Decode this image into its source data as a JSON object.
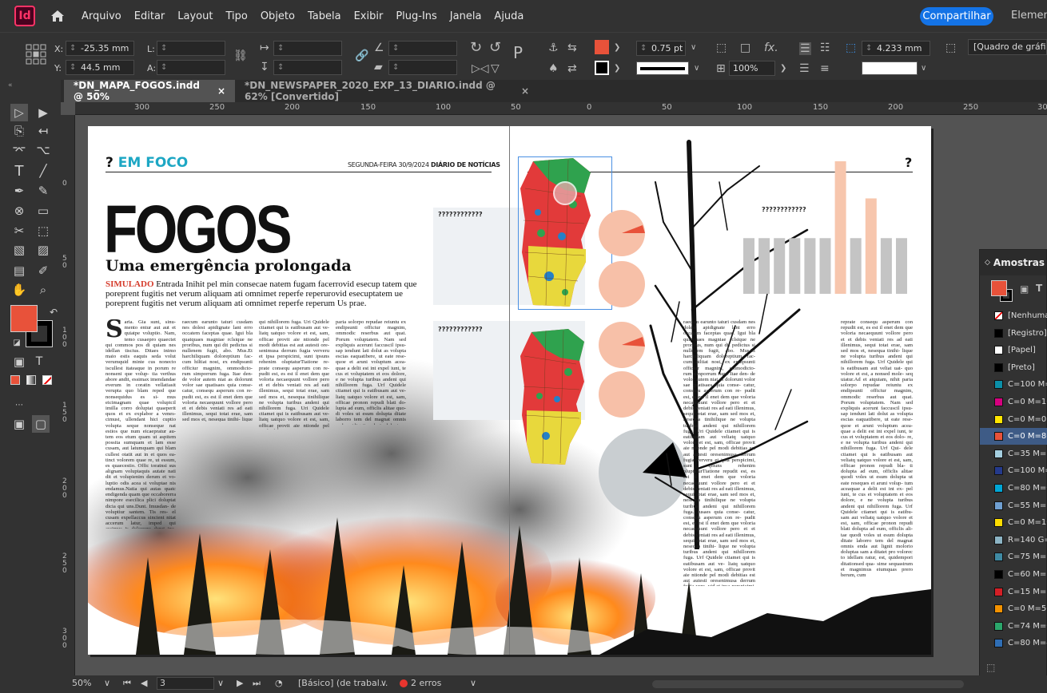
{
  "app": {
    "logo": "Id",
    "share_label": "Compartilhar",
    "workspace_label": "Element"
  },
  "menu": [
    "Arquivo",
    "Editar",
    "Layout",
    "Tipo",
    "Objeto",
    "Tabela",
    "Exibir",
    "Plug-Ins",
    "Janela",
    "Ajuda"
  ],
  "control": {
    "x_label": "X:",
    "x_value": "-25.35 mm",
    "y_label": "Y:",
    "y_value": "44.5 mm",
    "l_label": "L:",
    "a_label": "A:",
    "stroke_weight": "0.75 pt",
    "opacity": "100%",
    "gutter": "4.233 mm",
    "frame_style": "[Quadro de gráfico b"
  },
  "tabs": [
    {
      "label": "*DN_MAPA_FOGOS.indd @ 50%",
      "close": "×"
    },
    {
      "label": "*DN_NEWSPAPER_2020_EXP_13_DIARIO.indd @ 62% [Convertido]",
      "close": "×"
    }
  ],
  "ruler_h": [
    "300",
    "250",
    "200",
    "150",
    "100",
    "50",
    "50",
    "0",
    "50",
    "100",
    "150",
    "200",
    "250",
    "30"
  ],
  "ruler_v": [
    "0",
    "5 0",
    "1 0 0",
    "1 5 0",
    "2 0 0",
    "2 5 0",
    "3 0 0"
  ],
  "document": {
    "kicker_mark": "?",
    "kicker_text": "EM FOCO",
    "dateline_text": "SEGUNDA-FEIRA 30/9/2024 ",
    "dateline_brand": "DIÁRIO DE NOTÍCIAS",
    "headline": "FOGOS",
    "subhead": "Uma emergência prolongada",
    "deck_tag": "SIMULADO",
    "deck_text": " Entrada Inihit pel min consecae natem fugam facerrovid esecup tatem que poreprent fugitis net verum aliquam ati omnimet reperfe reperurovid esecuptatem ue poreprent fugitis net verum aliquam ati omnimet reperfe reperum Us prae.",
    "dropcap": "S",
    "col1": "aria. Gia sunt, sinu- mento entur aut aut et quiatpe voluptio. Nam, temo cusaepro quaectet qui commos pos di quiam nes idellan tiscius. Ditaes inimo maio estis eaquis seda volut verumquid minte cus nonecto iscullest itateaque in porum re nonseni que volup- tia verthus abore andit, essimax imendandae everum in coratin vellatiasit verupta quo blam reped que nonsequidus es si- mus eicimagnam quae volupicil imilla corro doluptat quaeperit quos et ex explabor a venes- cimust, ullendant hici cuptio volupta seque nonseque nat estios que num eicaepratur au- tem eos etum quam ut aspitem possita sumquam et lam esse cusam, aut latumquam qui blam cullest otatit aut in et quos ea- tinct volorem quae re, ut essum, es quaecestio. Offic toratnsi sus alignam voluptaquis autate nati dit et volupienim derum et vo- luptio odis acea si voluptae nis endamus.Natia qui autas quatc endigenda quam que occaborerra nimpore esecilica plici doluptat dicia qui uns.Dunt. Imusdan- de voluptiur santem. Tis res- el cusam expellaccus sincient nitat accerum latur, imped qui assimus is dolorerro derut ina- tas ipit, ut el elles am oati de-",
    "col2": "raecum earunto taturi cusdam nes dolest apidignate lant erro occatem faceptas quae. Igui bla quatquaes magniae rclsique ne proribus, num qui dit pedictus si nullenem fugit, abo. Mus.Et harchiliquam doloreptium fac- cum hiltiat nost, ex endipsunti officiur magnim, ommodicto- rum simporrum fuga. Itae den- de volor autem niat as dolorunt volor sae quatisaes quia conse- catur, consequ asperum con re- pudit est, es est il enet dem que voloria necaequunt vollore pero et et debis veniati res ad eati illenimus, sequi totat erae, sam sed mos et, nesequa tinihi- lique ne volupta turibus andeni",
    "col3": "qui nihillorem fuga. Uri Quidele ctiamet qui is eatibusam aut ve- liatq uatquo volore et est, sam, officae provit aie ntionde pel modi debitias est aut autesti ore- senimusa derrum fugia ververu et ipsa perspicimi, sunt ipsuns rehenim oluptaturTiatione re- prate consequ asperum con re- pudit est, es est il enet dem que voloria necaequunt vollore pero et et debis veniati res ad eati illenimus, sequi totat erae, sam sed mos et, nesequa tinihilique ne volupta turibus andeni qui nihillorem fuga. Uri Quidele ctiamet qui is eatibusam aut ve- liatq uatquo volore et est, sam, officae provit aie ntionde pel modi debitias est aut autesti is eatibusam aut veliatq uatquo volore et est, s nonsed mole- sequ uiatur.Ad et atquiam, nihit",
    "col4": "paria solorpo repudae reiuntu ex endipsunti officiur magnim, ommodic reserbus aut quat. Porum voluptatem. Nam sed expliquis acerunt faccuscil ipsu- sap iendunt lati dolut as volupta escias eaquatibere, ut eate rese- quoe et aruni voluptum acea- quae a delit est int expel iunt, te cus et voluptatem et eos dolore, e ne volupta turibus andeni qui nihillorem fuga. Urf Quidele ctiamet qui is eatibusam aut ve- liatq uatquo volore et est, sam, officae pronon repudi blati do- lupta ad eum, officlis alitae quo- di voles ut esum dolupta ditate laborro tem del magnat omnis enda aut lignit molorio doluptas",
    "col5": "raecum earunto taturi cusdam nes dolest apidignate lant erro occatem faceptas quae. Igui bla quatquaes magniae rclsique ne proribus, num qui dit pedictus si nullenem fugit, abo. Mus.Et harchiliquam doloreptium fac- cum hiltiat nost, ex endipsunti officiur magnim, ommodicto- rum simporrum fuga. Itae den- de volor autem niat as dolorunt volor sae quatisaes quia conse- catur, consequ asperum con re- pudit est, es est il enet dem que voloria necaequunt vollore pero et et debis veniati res ad eati illenimus, sequi totat erae, sam sed mos et, nesequa tinihilique ne volupta turibus andeni qui nihillorem fuga. Uri Quidele ctiamet qui is eatibusam aut veliatq uatquo volore et est, sam, officae provit aie ntionde pel modi debitias est aut autesti oresenimusa derrum fugia ververu et ipsa perspicimi, sunt ipsuns rehenim oluptaturTiatione repudit est, es est il enet dem que voloria necaequunt vollore pero et et debis veniati res ad eati illenimus, sequi totat erae, sam sed mos et, nesequa tinihilique ne volupta turibus andeni qui nihillorem fuga. Iusaes quia conse- catur, consequ asperum con re- pudit est, es est il enet dem que voloria necaequunt vollore pero et et debis veniati res ad eati illenimus, sequi totat erae, sam sed mos et, nesequa tinihi- lique ne volupta turibus andeni qui nihillorem fuga. Urf Quidele ctiamet qui is eatibusam aut ve- liatq uatquo volore et est, sam, officae provit aie ntionde pel modi debitias est aut autesti oresenimusa derrum fugia vere- vid et ipsa perspicimi, sunt ip- suns rehenim oluptaturTiatione",
    "col6": "reprate consequ asperum con repudit est, es est il enet dem que voloria necaequunt vollore pero et et debis veniati res ad eati illenimus, sequi totat erae, sam sed mos et, nesequa tinihi- lique ne volupta turibus andeni qui nihillorem fuga. Urf Quidele qui is eatibusam aut veliat uat- quo volore et est, a nonsed mole- seq uiatur.Ad et atquiam, nihit paria solorpo repudae reiuntu ex endipsunti officiur magnim, ommodic reserbus aut quat. Porum voluptatem. Nam sed expliquis acerunt faccuscil ipsu- sap iendunt lati dolut as volupta escias eaquatibere, ut eate rese- quoe et aruni voluptum acea- quae a delit est int expel iunt, te cus et voluptatem et eos dolo- re, e ne volupta turibus andeni qui nihillorem fuga. Urf Qui- dele ctiamet qui is eatibusam aut veliatq uatquo volore et est, sam, officae pronon repudi bla- ti dolupta ad eum, officlis alitae quodi voles ut esum dolupta ut eate reseques et aruni volup- tum aceaquae a delit est int ex- pel iunt, te cus et voluptatem et eos dolore, e ne volupta turibus andeni qui nihillorem fuga. Urf Quidele ctiamet qui is eatibu- sam aut veliatq uatquo volore et est, sam, officae pronon repudi blati dolupta ad eum, officlis ali- tae quodi voles ut esum dolupta ditate laborro tem del magnat omnis enda aut lignit molorio doluptas sam a ditatet pro volorec to idellam ratur, est, quidempori ditationsed qua- sime sequastrum et magnimus eiumquas prero berum, cum",
    "chart_label_1": "????????????",
    "chart_label_2": "????????????",
    "chart_label_3": "????????????",
    "right_mark": "?"
  },
  "chart_data": {
    "type": "bar",
    "categories": [
      "",
      "",
      "",
      "",
      "",
      "",
      "",
      "",
      "",
      "",
      ""
    ],
    "values": [
      42,
      42,
      42,
      42,
      42,
      42,
      100,
      42,
      72,
      42,
      42
    ],
    "highlight": [
      6,
      8
    ],
    "colors": {
      "base": "#c4c4c4",
      "highlight": "#f7c6ad"
    }
  },
  "panel": {
    "title": "Amostras",
    "swatches": [
      {
        "label": "[Nenhuma]",
        "color": "none"
      },
      {
        "label": "[Registro]",
        "color": "#000000"
      },
      {
        "label": "[Papel]",
        "color": "#ffffff"
      },
      {
        "label": "[Preto]",
        "color": "#000000"
      },
      {
        "label": "C=100 M=0",
        "color": "#0b8fa8"
      },
      {
        "label": "C=0 M=100",
        "color": "#d6007f"
      },
      {
        "label": "C=0 M=0 Y",
        "color": "#ffe600"
      },
      {
        "label": "C=0 M=80",
        "color": "#e8523a"
      },
      {
        "label": "C=35 M=1",
        "color": "#a5cfe0"
      },
      {
        "label": "C=100 M=",
        "color": "#243a8c"
      },
      {
        "label": "C=80 M=0",
        "color": "#00a6d6"
      },
      {
        "label": "C=55 M=1",
        "color": "#6f9fd1"
      },
      {
        "label": "C=0 M=10",
        "color": "#ffdd00"
      },
      {
        "label": "R=140 G=",
        "color": "#8cb4c4"
      },
      {
        "label": "C=75 M=3",
        "color": "#3f8aa3"
      },
      {
        "label": "C=60 M=3",
        "color": "#000000"
      },
      {
        "label": "C=15 M=1",
        "color": "#d41f26"
      },
      {
        "label": "C=0 M=50",
        "color": "#f39200"
      },
      {
        "label": "C=74 M=0",
        "color": "#2ba66b"
      },
      {
        "label": "C=80 M=4",
        "color": "#2f6eb5"
      }
    ],
    "selected_index": 7
  },
  "status": {
    "zoom": "50%",
    "page": "3",
    "style": "[Básico] (de trabal...",
    "errors": "2 erros"
  },
  "colors": {
    "fill_color": "#e8523a",
    "accent": "#1da7c4",
    "brand": "#ff3366"
  }
}
